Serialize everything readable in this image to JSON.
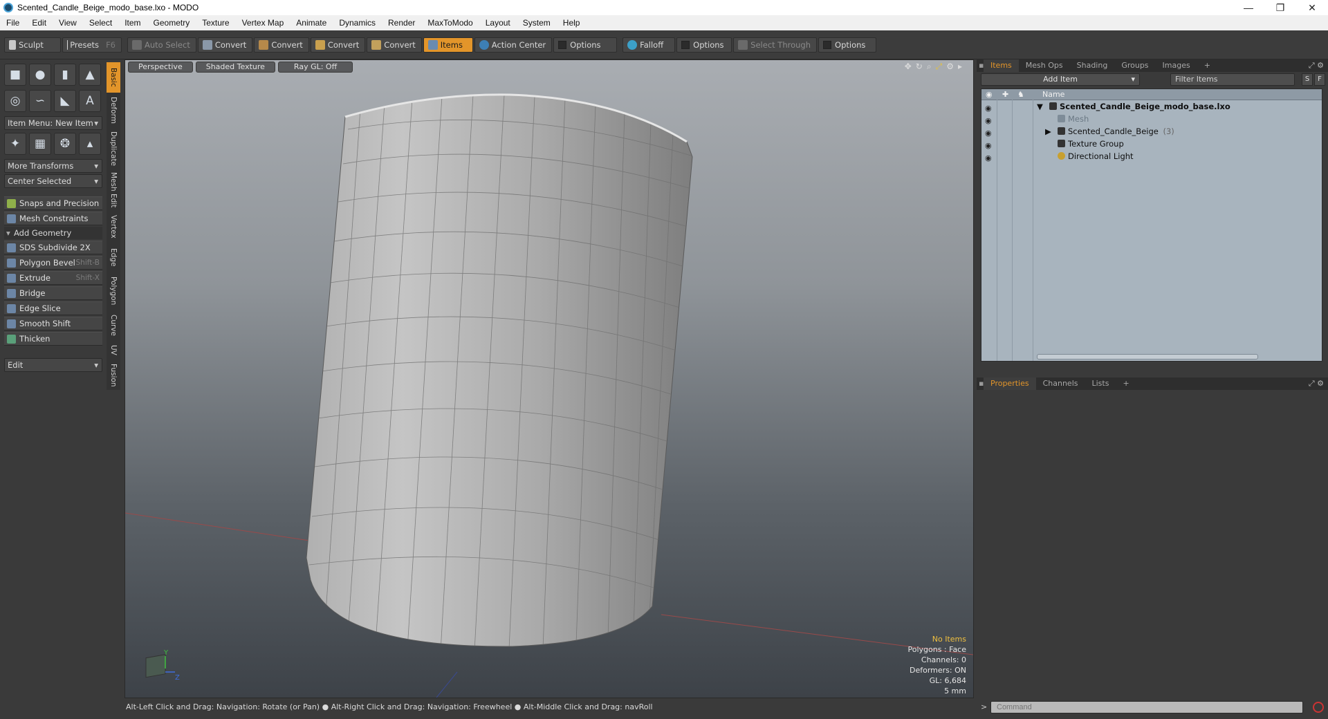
{
  "window": {
    "title": "Scented_Candle_Beige_modo_base.lxo - MODO",
    "controls": [
      "—",
      "❐",
      "✕"
    ]
  },
  "menu": [
    "File",
    "Edit",
    "View",
    "Select",
    "Item",
    "Geometry",
    "Texture",
    "Vertex Map",
    "Animate",
    "Dynamics",
    "Render",
    "MaxToModo",
    "Layout",
    "System",
    "Help"
  ],
  "toolbar": {
    "sculpt": "Sculpt",
    "presets": "Presets",
    "presets_key": "F6",
    "auto_select": "Auto Select",
    "convert1": "Convert",
    "convert2": "Convert",
    "convert3": "Convert",
    "convert4": "Convert",
    "items": "Items",
    "action_center": "Action Center",
    "options1": "Options",
    "falloff": "Falloff",
    "options2": "Options",
    "select_through": "Select Through",
    "options3": "Options",
    "accent": "#e3952a"
  },
  "left": {
    "item_menu": "Item Menu: New Item",
    "more_transforms": "More Transforms",
    "center_selected": "Center Selected",
    "snaps": "Snaps and Precision",
    "mesh_constraints": "Mesh Constraints",
    "add_geometry": "Add Geometry",
    "tools": [
      {
        "label": "SDS Subdivide 2X",
        "shortcut": ""
      },
      {
        "label": "Polygon Bevel",
        "shortcut": "Shift-B"
      },
      {
        "label": "Extrude",
        "shortcut": "Shift-X"
      },
      {
        "label": "Bridge",
        "shortcut": ""
      },
      {
        "label": "Edge Slice",
        "shortcut": ""
      },
      {
        "label": "Smooth Shift",
        "shortcut": ""
      },
      {
        "label": "Thicken",
        "shortcut": ""
      }
    ],
    "edit": "Edit",
    "vtabs": [
      "Basic",
      "Deform",
      "Duplicate",
      "Mesh Edit",
      "Vertex",
      "Edge",
      "Polygon",
      "Curve",
      "UV",
      "Fusion"
    ]
  },
  "viewport": {
    "tabs": [
      "Perspective",
      "Shaded Texture",
      "Ray GL: Off"
    ],
    "icons": [
      "move-icon",
      "rotate-icon",
      "zoom-icon",
      "fit-icon",
      "settings-icon",
      "expand-icon"
    ],
    "info": {
      "no_items": "No Items",
      "polygons": "Polygons : Face",
      "channels": "Channels: 0",
      "deformers": "Deformers: ON",
      "gl": "GL: 6,684",
      "scale": "5 mm"
    },
    "axis_labels": {
      "y": "Y",
      "z": "Z"
    }
  },
  "status": "Alt-Left Click and Drag: Navigation: Rotate (or Pan) ● Alt-Right Click and Drag: Navigation: Freewheel ● Alt-Middle Click and Drag: navRoll",
  "items_panel": {
    "tabs": [
      "Items",
      "Mesh Ops",
      "Shading",
      "Groups",
      "Images",
      "+"
    ],
    "add_item": "Add Item",
    "filter": "Filter Items",
    "s": "S",
    "f": "F",
    "col_name": "Name",
    "rows": [
      {
        "label": "Scented_Candle_Beige_modo_base.lxo",
        "expander": "▼",
        "bold": true
      },
      {
        "label": "Mesh",
        "expander": "",
        "dim": true
      },
      {
        "label": "Scented_Candle_Beige",
        "count": "(3)",
        "expander": "▶"
      },
      {
        "label": "Texture Group",
        "expander": ""
      },
      {
        "label": "Directional Light",
        "expander": ""
      }
    ]
  },
  "props_panel": {
    "tabs": [
      "Properties",
      "Channels",
      "Lists",
      "+"
    ]
  },
  "command": {
    "prompt": ">",
    "placeholder": "Command"
  }
}
